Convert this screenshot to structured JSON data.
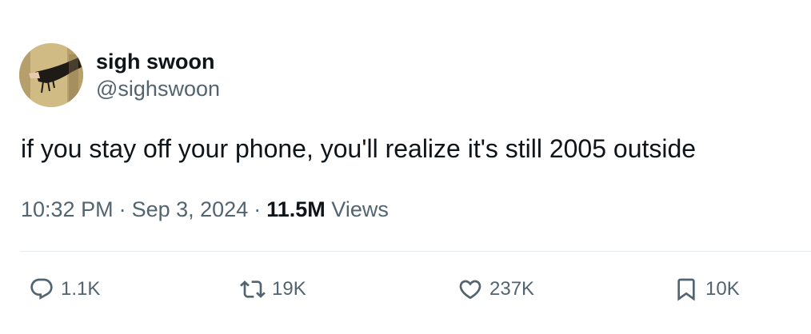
{
  "author": {
    "display_name": "sigh swoon",
    "handle": "@sighswoon",
    "avatar_icon": "profile-photo"
  },
  "tweet": {
    "text": "if you stay off your phone, you'll realize it's still 2005 outside",
    "time": "10:32 PM",
    "date": "Sep 3, 2024",
    "separator": "·",
    "views_count": "11.5M",
    "views_label": "Views"
  },
  "actions": {
    "reply": {
      "icon": "reply-icon",
      "count": "1.1K"
    },
    "retweet": {
      "icon": "retweet-icon",
      "count": "19K"
    },
    "like": {
      "icon": "heart-icon",
      "count": "237K"
    },
    "bookmark": {
      "icon": "bookmark-icon",
      "count": "10K"
    }
  },
  "colors": {
    "text_primary": "#0f1419",
    "text_secondary": "#536471",
    "divider": "#e6ecf0"
  }
}
